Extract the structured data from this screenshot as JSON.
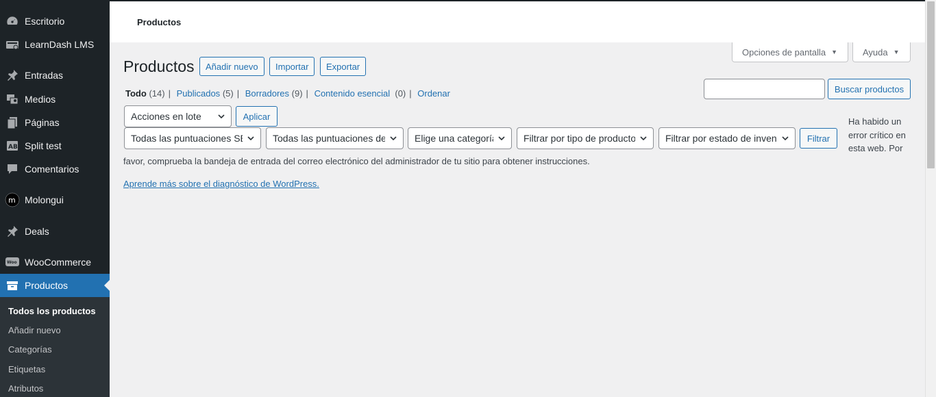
{
  "sidebar": {
    "items": [
      {
        "label": "Escritorio",
        "icon": "dashboard-icon"
      },
      {
        "label": "LearnDash LMS",
        "icon": "learndash-icon"
      },
      {
        "label": "Entradas",
        "icon": "pin-icon"
      },
      {
        "label": "Medios",
        "icon": "media-icon"
      },
      {
        "label": "Páginas",
        "icon": "pages-icon"
      },
      {
        "label": "Split test",
        "icon": "ab-test-icon"
      },
      {
        "label": "Comentarios",
        "icon": "comments-icon"
      },
      {
        "label": "Molongui",
        "icon": "molongui-icon"
      },
      {
        "label": "Deals",
        "icon": "pin-icon"
      },
      {
        "label": "WooCommerce",
        "icon": "woocommerce-icon"
      },
      {
        "label": "Productos",
        "icon": "archive-icon"
      }
    ],
    "submenu": [
      "Todos los productos",
      "Añadir nuevo",
      "Categorías",
      "Etiquetas",
      "Atributos"
    ]
  },
  "header": {
    "title": "Productos"
  },
  "screen_options": {
    "options_label": "Opciones de pantalla",
    "help_label": "Ayuda"
  },
  "page": {
    "title": "Productos",
    "add_new": "Añadir nuevo",
    "import": "Importar",
    "export": "Exportar"
  },
  "views": {
    "all": "Todo",
    "all_count": "(14)",
    "published": "Publicados",
    "published_count": "(5)",
    "drafts": "Borradores",
    "drafts_count": "(9)",
    "cornerstone": "Contenido esencial",
    "cornerstone_count": "(0)",
    "sort": "Ordenar"
  },
  "search": {
    "value": "",
    "button": "Buscar productos"
  },
  "bulk": {
    "selected": "Acciones en lote",
    "apply": "Aplicar"
  },
  "filters": {
    "seo_scores": "Todas las puntuaciones SEO",
    "readability_scores": "Todas las puntuaciones de legibilidad",
    "category": "Elige una categoría",
    "product_type": "Filtrar por tipo de producto",
    "stock_status": "Filtrar por estado de inventario",
    "filter_button": "Filtrar"
  },
  "error": {
    "line1a": "Ha habido un",
    "line1b": "error crítico en",
    "line1c": "esta web. Por",
    "line2": "favor, comprueba la bandeja de entrada del correo electrónico del administrador de tu sitio para obtener instrucciones.",
    "link": "Aprende más sobre el diagnóstico de WordPress."
  },
  "colors": {
    "accent": "#2271b1",
    "sidebar_bg": "#1d2327",
    "page_bg": "#f0f0f1"
  }
}
